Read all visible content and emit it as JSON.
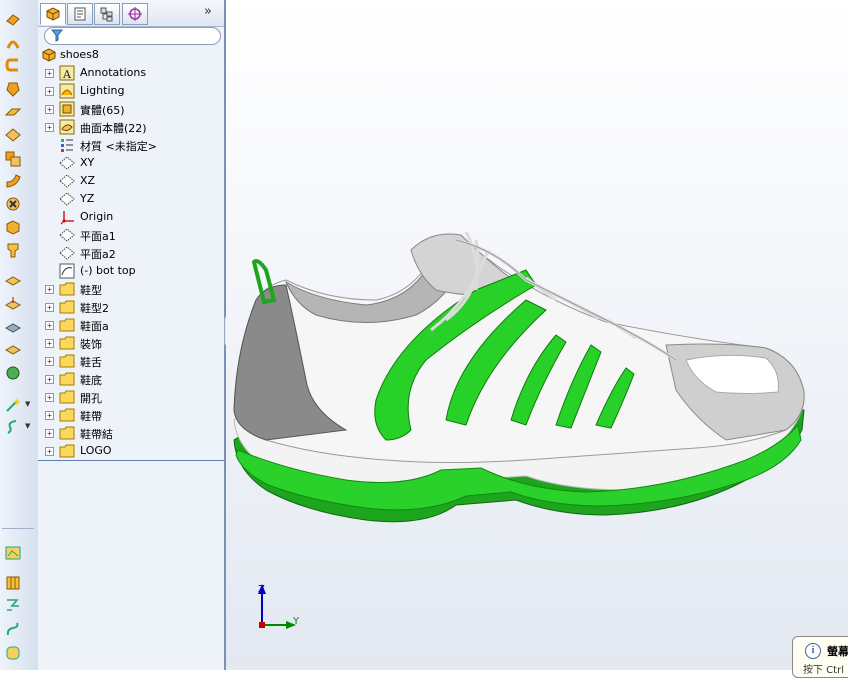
{
  "feature_tree": {
    "root": {
      "label": "shoes8",
      "icon": "part-icon"
    },
    "items": [
      {
        "label": "Annotations",
        "icon": "annotations-icon",
        "expandable": true
      },
      {
        "label": "Lighting",
        "icon": "lighting-icon",
        "expandable": true
      },
      {
        "label": "實體(65)",
        "icon": "solid-bodies-folder-icon",
        "expandable": true
      },
      {
        "label": "曲面本體(22)",
        "icon": "surface-bodies-folder-icon",
        "expandable": true
      },
      {
        "label": "材質 <未指定>",
        "icon": "material-icon",
        "expandable": false
      },
      {
        "label": "XY",
        "icon": "plane-icon",
        "expandable": false
      },
      {
        "label": "XZ",
        "icon": "plane-icon",
        "expandable": false
      },
      {
        "label": "YZ",
        "icon": "plane-icon",
        "expandable": false
      },
      {
        "label": "Origin",
        "icon": "origin-icon",
        "expandable": false
      },
      {
        "label": "平面a1",
        "icon": "plane-icon",
        "expandable": false
      },
      {
        "label": "平面a2",
        "icon": "plane-icon",
        "expandable": false
      },
      {
        "label": "(-) bot top",
        "icon": "sketch-icon",
        "expandable": false
      },
      {
        "label": "鞋型",
        "icon": "folder-icon",
        "expandable": true
      },
      {
        "label": "鞋型2",
        "icon": "folder-icon",
        "expandable": true
      },
      {
        "label": "鞋面a",
        "icon": "folder-icon",
        "expandable": true
      },
      {
        "label": "裝饰",
        "icon": "folder-icon",
        "expandable": true
      },
      {
        "label": "鞋舌",
        "icon": "folder-icon",
        "expandable": true
      },
      {
        "label": "鞋底",
        "icon": "folder-icon",
        "expandable": true
      },
      {
        "label": "開孔",
        "icon": "folder-icon",
        "expandable": true
      },
      {
        "label": "鞋帶",
        "icon": "folder-icon",
        "expandable": true
      },
      {
        "label": "鞋帶結",
        "icon": "folder-icon",
        "expandable": true
      },
      {
        "label": "LOGO",
        "icon": "folder-icon",
        "expandable": true
      }
    ]
  },
  "panel_tabs": [
    {
      "name": "featuremanager-tab",
      "icon": "feature-tree-icon",
      "active": true
    },
    {
      "name": "propertymanager-tab",
      "icon": "property-icon",
      "active": false
    },
    {
      "name": "configurationmanager-tab",
      "icon": "configuration-icon",
      "active": false
    },
    {
      "name": "dimxpert-tab",
      "icon": "crosshair-icon",
      "active": false
    }
  ],
  "panel_expand_glyph": "»",
  "filter_icon": "funnel-icon",
  "triad": {
    "x_label": "Y",
    "y_label": "Z"
  },
  "notification": {
    "icon_text": "i",
    "title": "螢幕",
    "body": "按下 Ctrl"
  },
  "colors": {
    "accent_green": "#22cc22",
    "tree_bg": "#eef2f9",
    "viewport_bg": "#e3e8f1"
  }
}
